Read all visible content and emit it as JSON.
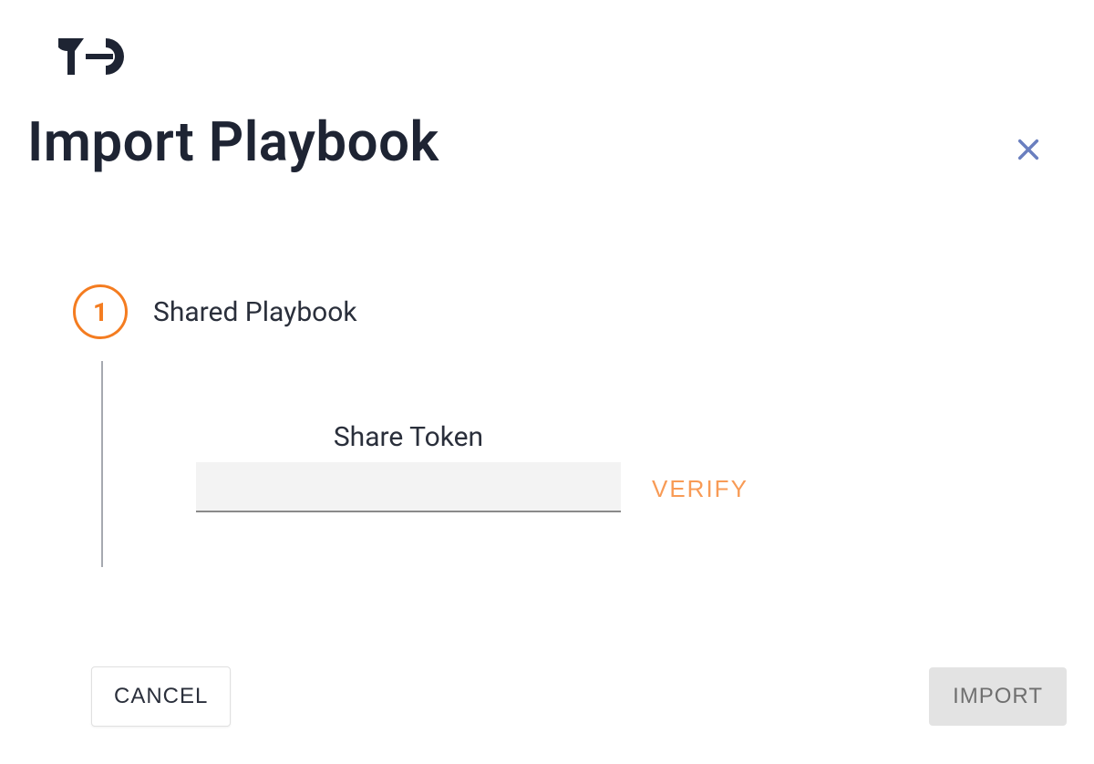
{
  "header": {
    "title": "Import Playbook"
  },
  "step": {
    "number": "1",
    "label": "Shared Playbook"
  },
  "field": {
    "label": "Share Token",
    "value": "",
    "verify_label": "VERIFY"
  },
  "footer": {
    "cancel_label": "CANCEL",
    "import_label": "IMPORT"
  }
}
